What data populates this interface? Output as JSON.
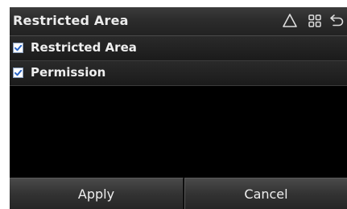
{
  "header": {
    "title": "Restricted Area",
    "icons": [
      "navigation-icon",
      "grid-menu-icon",
      "back-icon"
    ]
  },
  "options": [
    {
      "label": "Restricted Area",
      "checked": true
    },
    {
      "label": "Permission",
      "checked": true
    }
  ],
  "footer": {
    "apply_label": "Apply",
    "cancel_label": "Cancel"
  },
  "colors": {
    "background": "#000000",
    "header": "#2c2c2c",
    "checkbox_mark": "#2a66c8",
    "text": "#eeeeee"
  }
}
